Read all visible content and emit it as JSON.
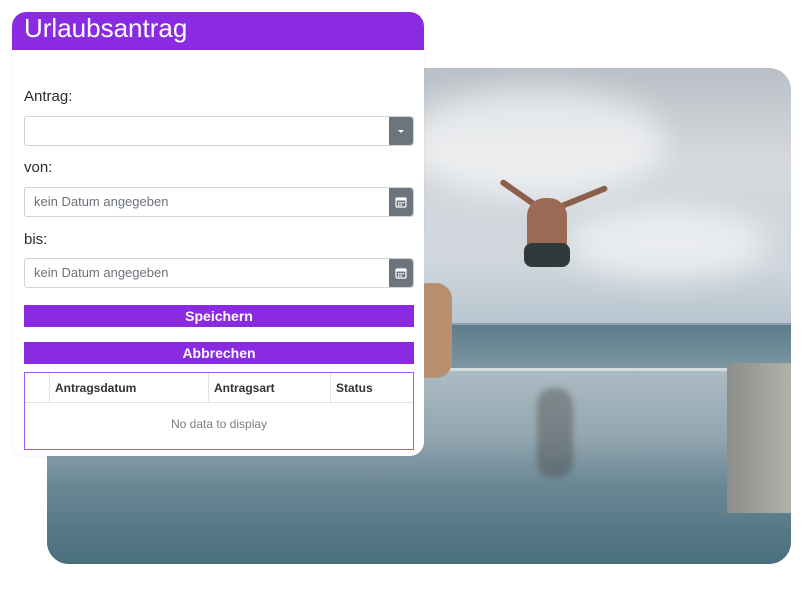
{
  "page": {
    "title": "Urlaubsantrag"
  },
  "form": {
    "antrag": {
      "label": "Antrag:",
      "value": ""
    },
    "von": {
      "label": "von:",
      "placeholder": "kein Datum angegeben"
    },
    "bis": {
      "label": "bis:",
      "placeholder": "kein Datum angegeben"
    }
  },
  "buttons": {
    "save_label": "Speichern",
    "cancel_label": "Abbrechen"
  },
  "grid": {
    "columns": [
      "Antragsdatum",
      "Antragsart",
      "Status"
    ],
    "empty_text": "No data to display"
  },
  "icons": {
    "dropdown": "chevron-down-icon",
    "calendar": "calendar-icon"
  },
  "colors": {
    "accent": "#8a2be2",
    "addon": "#6c757d",
    "grid_border": "#a855f7"
  }
}
